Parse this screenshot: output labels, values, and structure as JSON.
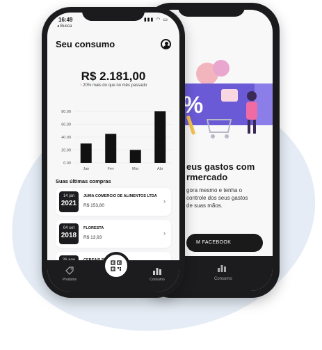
{
  "back_phone": {
    "title": "eus gastos com\nrmercado",
    "body": "gora mesmo e tenha o\ncontrole dos seus gastos\nde suas mãos.",
    "button": "M FACEBOOK",
    "nav_label": "Consumo"
  },
  "status": {
    "time": "16:49",
    "back": "◂ Busca",
    "icons": "▮▮▮ ◠ ▭"
  },
  "header": {
    "title": "Seu consumo"
  },
  "summary": {
    "total": "R$ 2.181,00",
    "change": "20% mais do que no mês passado"
  },
  "chart_data": {
    "type": "bar",
    "categories": [
      "Jan",
      "Fev",
      "Mar",
      "Abr"
    ],
    "values": [
      30,
      45,
      20,
      80
    ],
    "ytick_labels": [
      "80.00",
      "60.00",
      "40.00",
      "20.00",
      "0.00"
    ],
    "ylim": [
      0,
      80
    ],
    "bar_color": "#111111",
    "grid": true
  },
  "purchases": {
    "title": "Suas últimas compras",
    "items": [
      {
        "day": "14 jan",
        "year": "2021",
        "merchant": "JUMA COMERCIO DE ALIMENTOS LTDA",
        "amount": "R$ 153,80"
      },
      {
        "day": "04 set",
        "year": "2018",
        "merchant": "FLORESTA",
        "amount": "R$ 13,93"
      },
      {
        "day": "26 ago",
        "year": "",
        "merchant": "CEREAIS BRAMIL LTDA",
        "amount": ""
      }
    ]
  },
  "nav": {
    "products": "Produtos",
    "consumption": "Consumo"
  },
  "colors": {
    "accent": "#e23b3b",
    "dark": "#1c1c1e",
    "background_blob": "#e5ecf5"
  }
}
